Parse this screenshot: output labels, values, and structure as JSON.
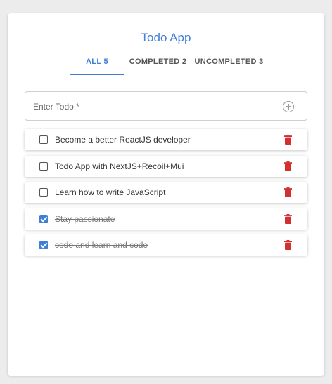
{
  "app": {
    "title": "Todo App",
    "accent": "#3f7fd6",
    "delete_color": "#d32f2f"
  },
  "tabs": [
    {
      "label": "ALL 5",
      "active": true
    },
    {
      "label": "COMPLETED 2",
      "active": false
    },
    {
      "label": "UNCOMPLETED 3",
      "active": false
    }
  ],
  "input": {
    "placeholder": "Enter Todo *",
    "value": "",
    "add_icon": "add-circle-icon"
  },
  "todos": [
    {
      "text": "Become a better ReactJS developer",
      "completed": false
    },
    {
      "text": "Todo App with NextJS+Recoil+Mui",
      "completed": false
    },
    {
      "text": "Learn how to write JavaScript",
      "completed": false
    },
    {
      "text": "Stay passionate",
      "completed": true
    },
    {
      "text": "code and learn and code",
      "completed": true
    }
  ],
  "icons": {
    "delete": "trash-icon",
    "checkbox": "checkbox-icon"
  }
}
